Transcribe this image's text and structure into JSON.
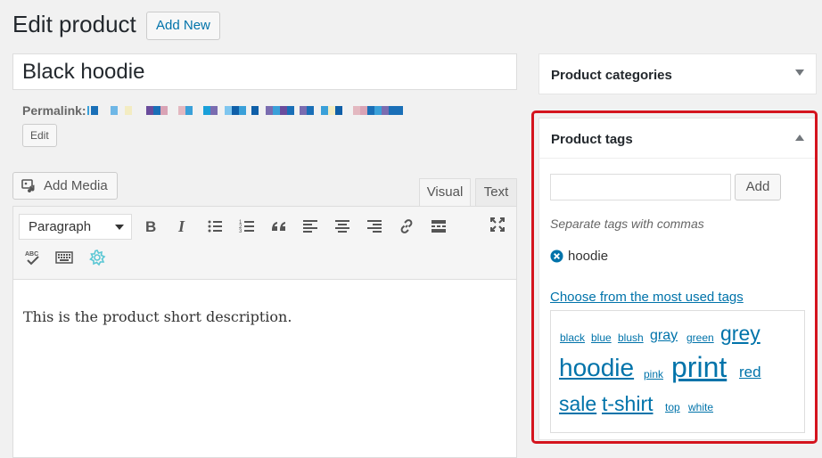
{
  "header": {
    "title": "Edit product",
    "add_new_label": "Add New"
  },
  "post": {
    "title_value": "Black hoodie",
    "permalink_label": "Permalink:",
    "edit_label": "Edit"
  },
  "editor": {
    "add_media_label": "Add Media",
    "tabs": {
      "visual": "Visual",
      "text": "Text"
    },
    "format_select_value": "Paragraph",
    "toolbar_icons": [
      "bold-icon",
      "italic-icon",
      "bulleted-list-icon",
      "numbered-list-icon",
      "blockquote-icon",
      "align-left-icon",
      "align-center-icon",
      "align-right-icon",
      "link-icon",
      "read-more-icon",
      "fullscreen-icon",
      "spellcheck-icon",
      "keyboard-icon",
      "grammarly-icon"
    ],
    "content": "This is the product short description."
  },
  "sidebar": {
    "categories_title": "Product categories",
    "tags": {
      "title": "Product tags",
      "add_label": "Add",
      "hint": "Separate tags with commas",
      "current_tags": [
        "hoodie"
      ],
      "most_used_link": "Choose from the most used tags",
      "cloud": {
        "black": "black",
        "blue": "blue",
        "blush": "blush",
        "gray": "gray",
        "green": "green",
        "grey": "grey",
        "hoodie": "hoodie",
        "pink": "pink",
        "print": "print",
        "red": "red",
        "sale": "sale",
        "tshirt": "t-shirt",
        "top": "top",
        "white": "white"
      }
    }
  },
  "colors": {
    "link": "#0073aa",
    "highlight": "#d4141e",
    "background": "#f1f1f1"
  }
}
